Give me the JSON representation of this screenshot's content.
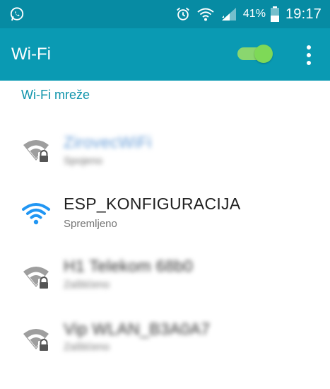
{
  "status_bar": {
    "app_icon": "whatsapp-icon",
    "icons": [
      "alarm-icon",
      "wifi-icon",
      "signal-icon",
      "battery-icon"
    ],
    "battery_percent": "41%",
    "time": "19:17"
  },
  "app_bar": {
    "title": "Wi-Fi",
    "toggle_on": true,
    "overflow_icon": "more-vert-icon"
  },
  "section": {
    "title": "Wi-Fi mreže"
  },
  "networks": [
    {
      "name": "ZirovecWiFi",
      "status": "Spojeno",
      "secured": true,
      "blurred": true
    },
    {
      "name": "ESP_KONFIGURACIJA",
      "status": "Spremljeno",
      "secured": false,
      "blurred": false
    },
    {
      "name": "H1 Telekom 68b0",
      "status": "Zaštićeno",
      "secured": true,
      "blurred": true
    },
    {
      "name": "Vip WLAN_B3A0A7",
      "status": "Zaštićeno",
      "secured": true,
      "blurred": true
    }
  ],
  "colors": {
    "status_bar": "#078ba3",
    "app_bar": "#0a9ab3",
    "accent": "#1094ab",
    "toggle": "#7ed957",
    "wifi_active": "#2196f3",
    "wifi_inactive": "#9e9e9e"
  }
}
